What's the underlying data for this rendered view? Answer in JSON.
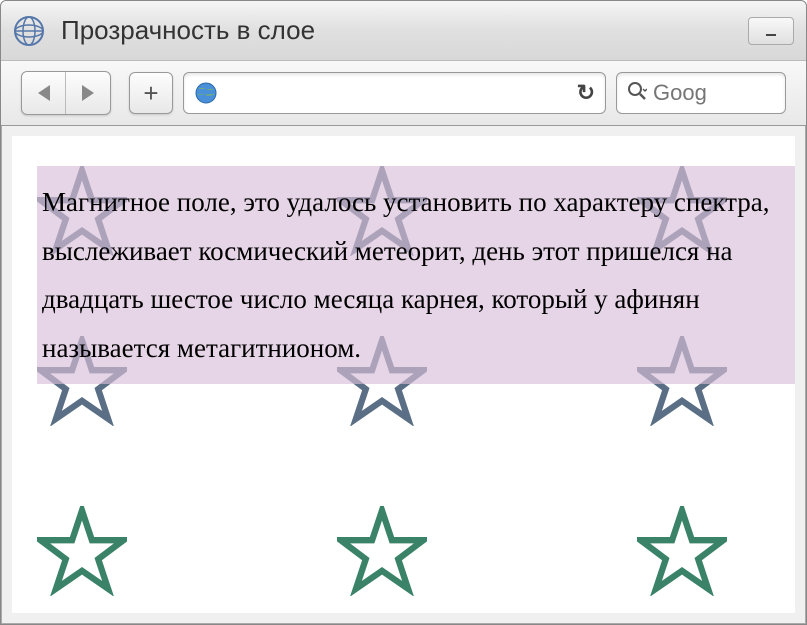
{
  "window": {
    "title": "Прозрачность в слое"
  },
  "toolbar": {
    "add_label": "+",
    "search_placeholder": "Goog"
  },
  "page": {
    "text": "Магнитное поле, это удалось установить по характеру спектра, выслеживает космический метеорит, день этот пришелся на двадцать шестое число месяца карнея, который у афинян называется метагитнионом."
  },
  "stars": {
    "row1_color": "#5a6f85",
    "row2_color": "#5a6f85",
    "row3_color": "#3a8268"
  }
}
